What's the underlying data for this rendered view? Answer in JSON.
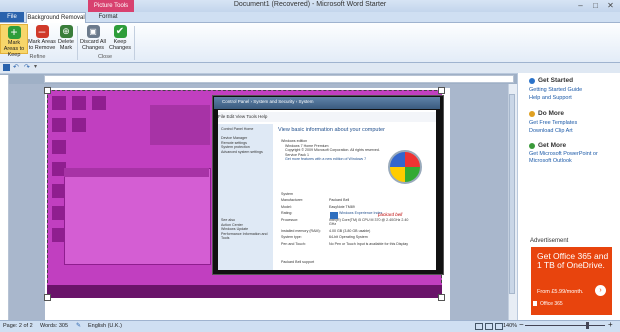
{
  "window": {
    "title": "Document1 (Recovered) - Microsoft Word Starter",
    "picture_tools": "Picture Tools",
    "controls": {
      "minimize": "–",
      "maximize": "□",
      "close": "✕"
    }
  },
  "tabs": {
    "file": "File",
    "background_removal": "Background Removal",
    "format": "Format"
  },
  "ribbon": {
    "buttons": [
      {
        "label": "Mark Areas to Keep",
        "icon": "plus-icon",
        "color": "#2e9d3a"
      },
      {
        "label": "Mark Areas to Remove",
        "icon": "minus-icon",
        "color": "#d03a2a"
      },
      {
        "label": "Delete Mark",
        "icon": "delete-mark-icon",
        "color": "#3a7d3a"
      },
      {
        "label": "Discard All Changes",
        "icon": "discard-icon",
        "color": "#6b7a8c"
      },
      {
        "label": "Keep Changes",
        "icon": "checkmark-icon",
        "color": "#2e9d3a"
      }
    ],
    "groups": {
      "refine": "Refine",
      "close": "Close"
    }
  },
  "screenshot_content": {
    "window_title": "Control Panel › System and Security › System",
    "menu": "File   Edit   View   Tools   Help",
    "heading": "View basic information about your computer",
    "sidebar": [
      "Control Panel Home",
      "Device Manager",
      "Remote settings",
      "System protection",
      "Advanced system settings",
      "See also",
      "Action Center",
      "Windows Update",
      "Performance Information and Tools"
    ],
    "edition_label": "Windows edition",
    "edition": "Windows 7 Home Premium",
    "copyright": "Copyright © 2009 Microsoft Corporation.  All rights reserved.",
    "service_pack": "Service Pack 1",
    "more_features": "Get more features with a new edition of Windows 7",
    "system_label": "System",
    "rows": [
      {
        "k": "Manufacturer:",
        "v": "Packard Bell"
      },
      {
        "k": "Model:",
        "v": "EasyNote TM89"
      },
      {
        "k": "Rating:",
        "v": "Windows Experience Index"
      },
      {
        "k": "Processor:",
        "v": "Intel(R) Core(TM) i5 CPU   M 370 @ 2.40GHz   2.40 GHz"
      },
      {
        "k": "Installed memory (RAM):",
        "v": "4.00 GB (3.80 GB usable)"
      },
      {
        "k": "System type:",
        "v": "64-bit Operating System"
      },
      {
        "k": "Pen and Touch:",
        "v": "No Pen or Touch Input is available for this Display"
      }
    ],
    "support": "Packard Bell support",
    "brand": "packard bell"
  },
  "right_pane": {
    "sections": [
      {
        "title": "Get Started",
        "links": [
          "Getting Started Guide",
          "Help and Support"
        ]
      },
      {
        "title": "Do More",
        "links": [
          "Get Free Templates",
          "Download Clip Art"
        ]
      },
      {
        "title": "Get More",
        "links": [
          "Get Microsoft PowerPoint or Microsoft Outlook"
        ]
      }
    ],
    "ad_label": "Advertisement",
    "ad_headline": "Get Office 365 and 1 TB of OneDrive.",
    "ad_price": "From £5.99/month.",
    "ad_brand": "Office 365",
    "ad_color": "#e8440d"
  },
  "status": {
    "page": "Page: 2 of 2",
    "words": "Words: 305",
    "language": "English (U.K.)",
    "zoom": "140%"
  }
}
